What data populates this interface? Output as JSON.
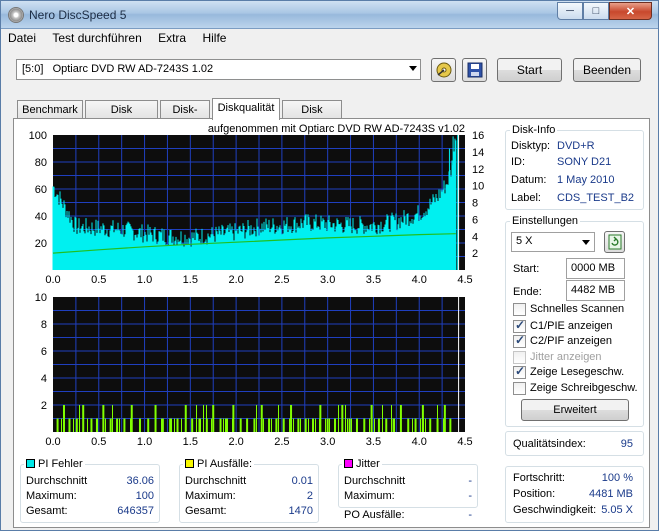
{
  "window": {
    "title": "Nero DiscSpeed 5",
    "min": "─",
    "max": "□",
    "close": "✕"
  },
  "menu": [
    "Datei",
    "Test durchführen",
    "Extra",
    "Hilfe"
  ],
  "toolbar": {
    "drive": "[5:0]   Optiarc DVD RW AD-7243S 1.02",
    "start": "Start",
    "end": "Beenden"
  },
  "tabs": [
    "Benchmark",
    "Disk erstellen",
    "Disk-Info",
    "Diskqualität",
    "Disk prüfen"
  ],
  "active_tab": "Diskqualität",
  "chart_caption": "aufgenommen mit Optiarc DVD RW AD-7243S  v1.02",
  "disk_info": {
    "title": "Disk-Info",
    "rows": [
      {
        "label": "Disktyp:",
        "value": "DVD+R"
      },
      {
        "label": "ID:",
        "value": "SONY D21"
      },
      {
        "label": "Datum:",
        "value": "1 May 2010"
      },
      {
        "label": "Label:",
        "value": "CDS_TEST_B2"
      }
    ]
  },
  "settings": {
    "title": "Einstellungen",
    "speed": "5 X",
    "start_label": "Start:",
    "start_value": "0000 MB",
    "end_label": "Ende:",
    "end_value": "4482 MB",
    "checkboxes": [
      {
        "label": "Schnelles Scannen",
        "checked": false,
        "disabled": false
      },
      {
        "label": "C1/PIE anzeigen",
        "checked": true,
        "disabled": false
      },
      {
        "label": "C2/PIF anzeigen",
        "checked": true,
        "disabled": false
      },
      {
        "label": "Jitter anzeigen",
        "checked": false,
        "disabled": true
      },
      {
        "label": "Zeige Lesegeschw.",
        "checked": true,
        "disabled": false
      },
      {
        "label": "Zeige Schreibgeschw.",
        "checked": false,
        "disabled": false
      }
    ],
    "advanced": "Erweitert"
  },
  "quality": {
    "label": "Qualitätsindex:",
    "value": "95"
  },
  "progress": {
    "rows": [
      {
        "label": "Fortschritt:",
        "value": "100 %"
      },
      {
        "label": "Position:",
        "value": "4481 MB"
      },
      {
        "label": "Geschwindigkeit:",
        "value": "5.05 X"
      }
    ]
  },
  "stats": {
    "pi_errors": {
      "title": "PI Fehler",
      "color": "#00e8e8",
      "rows": [
        {
          "label": "Durchschnitt",
          "value": "36.06"
        },
        {
          "label": "Maximum:",
          "value": "100"
        },
        {
          "label": "Gesamt:",
          "value": "646357"
        }
      ]
    },
    "pi_failures": {
      "title": "PI Ausfälle:",
      "color": "#f8f800",
      "rows": [
        {
          "label": "Durchschnitt",
          "value": "0.01"
        },
        {
          "label": "Maximum:",
          "value": "2"
        },
        {
          "label": "Gesamt:",
          "value": "1470"
        }
      ]
    },
    "jitter": {
      "title": "Jitter",
      "color": "#ff00ff",
      "rows": [
        {
          "label": "Durchschnitt",
          "value": "-"
        },
        {
          "label": "Maximum:",
          "value": "-"
        }
      ],
      "po_label": "PO Ausfälle:",
      "po_value": "-"
    }
  },
  "colors": {
    "plot_bg": "#0d0d0d",
    "grid": "#1f3fbf",
    "pi": "#00f0f0",
    "pif": "#80ff00",
    "speed": "#20c020",
    "marker": "#ffffff"
  },
  "chart_data": [
    {
      "type": "area",
      "title": "aufgenommen mit Optiarc DVD RW AD-7243S  v1.02",
      "xlim": [
        0,
        4.5
      ],
      "ylim": [
        0,
        100
      ],
      "y2lim": [
        0,
        16
      ],
      "xticks": [
        "0.0",
        "0.5",
        "1.0",
        "1.5",
        "2.0",
        "2.5",
        "3.0",
        "3.5",
        "4.0",
        "4.5"
      ],
      "yticks": [
        "100",
        "80",
        "60",
        "40",
        "20"
      ],
      "y2ticks": [
        "16",
        "14",
        "12",
        "10",
        "8",
        "6",
        "4",
        "2"
      ],
      "grid": true,
      "series": [
        {
          "name": "PI Fehler",
          "x": [
            0.0,
            0.25,
            0.5,
            0.75,
            1.0,
            1.25,
            1.5,
            1.75,
            2.0,
            2.25,
            2.5,
            2.75,
            3.0,
            3.25,
            3.5,
            3.75,
            4.0,
            4.1,
            4.2,
            4.3,
            4.35,
            4.4
          ],
          "y": [
            60,
            30,
            29,
            28,
            25,
            23,
            22,
            24,
            26,
            30,
            31,
            33,
            32,
            31,
            31,
            34,
            40,
            45,
            52,
            62,
            72,
            96
          ]
        },
        {
          "name": "Lesegeschwindigkeit",
          "x": [
            0.0,
            0.5,
            1.0,
            1.5,
            2.0,
            2.5,
            3.0,
            3.5,
            4.0,
            4.4
          ],
          "y": [
            2.0,
            2.4,
            2.75,
            3.05,
            3.3,
            3.55,
            3.8,
            4.0,
            4.2,
            4.3
          ]
        }
      ]
    },
    {
      "type": "bar",
      "xlim": [
        0,
        4.5
      ],
      "ylim": [
        0,
        10
      ],
      "xticks": [
        "0.0",
        "0.5",
        "1.0",
        "1.5",
        "2.0",
        "2.5",
        "3.0",
        "3.5",
        "4.0",
        "4.5"
      ],
      "yticks": [
        "10",
        "8",
        "6",
        "4",
        "2"
      ],
      "grid": true,
      "series": [
        {
          "name": "PI Ausfälle",
          "x": [
            0.05,
            0.12,
            0.18,
            0.26,
            0.33,
            0.42,
            0.48,
            0.55,
            0.63,
            0.7,
            0.78,
            0.86,
            0.95,
            1.04,
            1.12,
            1.2,
            1.28,
            1.36,
            1.45,
            1.52,
            1.6,
            1.68,
            1.75,
            1.83,
            1.9,
            1.97,
            2.05,
            2.12,
            2.2,
            2.28,
            2.36,
            2.44,
            2.52,
            2.6,
            2.68,
            2.76,
            2.84,
            2.92,
            3.0,
            3.08,
            3.16,
            3.24,
            3.32,
            3.4,
            3.48,
            3.56,
            3.64,
            3.72,
            3.8,
            3.88,
            3.96,
            4.04,
            4.12,
            4.2,
            4.28,
            4.34
          ],
          "y": [
            1,
            2,
            1,
            1,
            2,
            1,
            1,
            2,
            1,
            1,
            1,
            2,
            1,
            1,
            2,
            1,
            1,
            1,
            2,
            1,
            1,
            1,
            2,
            1,
            1,
            2,
            1,
            1,
            1,
            2,
            1,
            1,
            1,
            2,
            1,
            1,
            1,
            2,
            1,
            1,
            2,
            1,
            1,
            1,
            2,
            1,
            1,
            1,
            2,
            1,
            1,
            2,
            1,
            1,
            2,
            1
          ]
        }
      ]
    }
  ]
}
